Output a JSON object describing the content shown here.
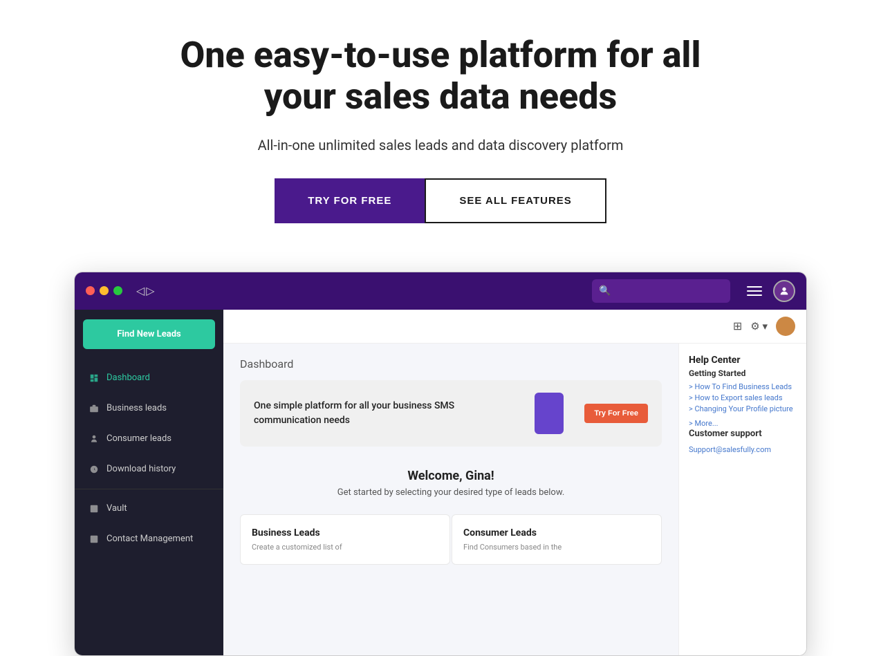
{
  "hero": {
    "title": "One easy-to-use platform for all your sales data needs",
    "subtitle": "All-in-one unlimited sales leads and data discovery platform",
    "btn_primary": "TRY FOR FREE",
    "btn_secondary": "SEE ALL FEATURES"
  },
  "app": {
    "topbar": {
      "nav_arrows": "◁▷",
      "search_placeholder": ""
    },
    "sidebar": {
      "find_leads_btn": "Find New Leads",
      "items": [
        {
          "label": "Dashboard",
          "icon": "dashboard",
          "active": true
        },
        {
          "label": "Business leads",
          "icon": "briefcase",
          "active": false
        },
        {
          "label": "Consumer leads",
          "icon": "person",
          "active": false
        },
        {
          "label": "Download history",
          "icon": "history",
          "active": false
        },
        {
          "label": "Vault",
          "icon": "vault",
          "active": false
        },
        {
          "label": "Contact Management",
          "icon": "contact",
          "active": false
        }
      ]
    },
    "inner_topbar": {
      "grid_icon": "⊞",
      "settings_icon": "⚙"
    },
    "main": {
      "dashboard_label": "Dashboard",
      "banner": {
        "text": "One simple platform for all your business SMS communication needs",
        "try_btn": "Try For Free"
      },
      "welcome_title": "Welcome, Gina!",
      "welcome_sub": "Get started by selecting your desired type of leads below.",
      "leads_cards": [
        {
          "title": "Business Leads",
          "desc": "Create a customized list of"
        },
        {
          "title": "Consumer Leads",
          "desc": "Find Consumers based in the"
        }
      ]
    },
    "help_panel": {
      "title": "Help Center",
      "getting_started": "Getting Started",
      "links": [
        "> How To Find Business Leads",
        "> How to Export sales leads",
        "> Changing Your Profile picture"
      ],
      "more": "> More...",
      "customer_support": "Customer support",
      "email": "Support@salesfully.com"
    }
  }
}
